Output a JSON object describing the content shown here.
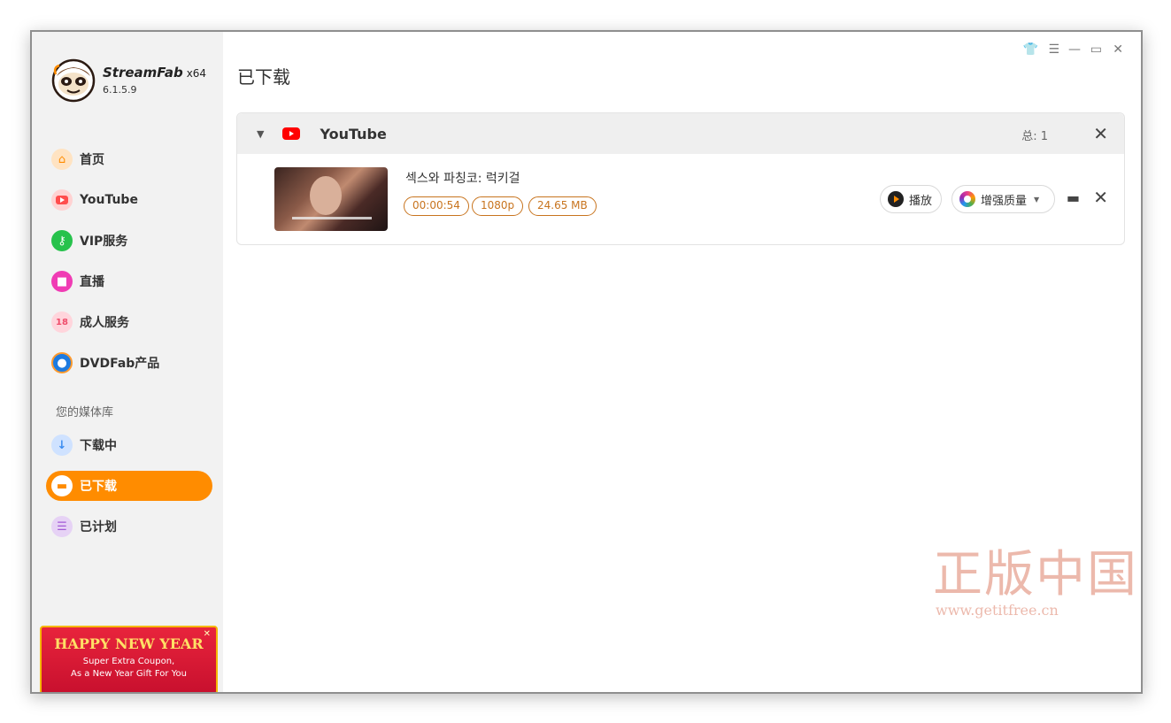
{
  "app": {
    "name": "StreamFab",
    "arch": "x64",
    "version": "6.1.5.9"
  },
  "sidebar": {
    "items": [
      {
        "label": "首页",
        "icon": "home-icon",
        "color": "#ff9a2e"
      },
      {
        "label": "YouTube",
        "icon": "youtube-icon",
        "color": "#ff4d4d"
      },
      {
        "label": "VIP服务",
        "icon": "key-icon",
        "color": "#27c24c"
      },
      {
        "label": "直播",
        "icon": "live-camera-icon",
        "color": "#f03cb4"
      },
      {
        "label": "成人服务",
        "icon": "adult-icon",
        "color": "#ef4d6b"
      },
      {
        "label": "DVDFab产品",
        "icon": "dvdfab-icon",
        "color": "#1e7be0"
      }
    ],
    "library_label": "您的媒体库",
    "library": [
      {
        "label": "下载中",
        "icon": "download-icon",
        "color": "#3b8cf0"
      },
      {
        "label": "已下载",
        "icon": "folder-icon",
        "color": "#ff8c00",
        "active": true
      },
      {
        "label": "已计划",
        "icon": "schedule-icon",
        "color": "#a35ad6"
      }
    ],
    "promo": {
      "title": "HAPPY NEW YEAR",
      "line1": "Super Extra Coupon,",
      "line2": "As a New Year Gift For You"
    }
  },
  "main": {
    "title": "已下载",
    "group": {
      "name": "YouTube",
      "total": "总: 1",
      "items": [
        {
          "title": "섹스와 파칭코: 럭키걸",
          "duration": "00:00:54",
          "resolution": "1080p",
          "size": "24.65 MB",
          "play_label": "播放",
          "enhance_label": "增强质量"
        }
      ]
    }
  },
  "watermark": {
    "text": "正版中国",
    "url": "www.getitfree.cn"
  },
  "colors": {
    "accent": "#ff8c00",
    "tag": "#c8741e",
    "sidebar_bg": "#f2f2f2"
  }
}
